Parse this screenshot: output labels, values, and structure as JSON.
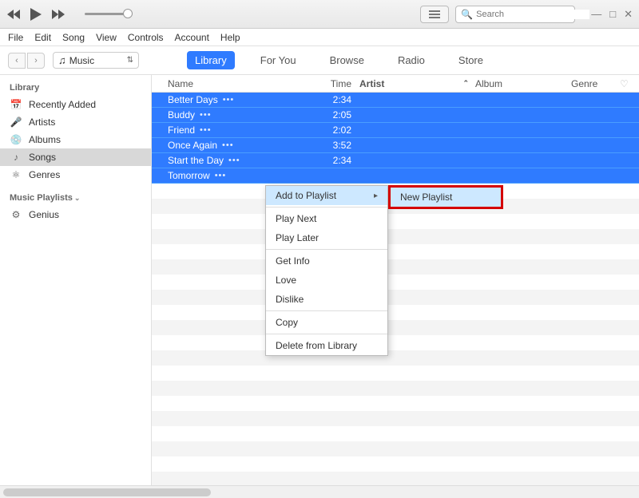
{
  "search": {
    "placeholder": "Search"
  },
  "menus": [
    "File",
    "Edit",
    "Song",
    "View",
    "Controls",
    "Account",
    "Help"
  ],
  "mediaPicker": {
    "label": "Music"
  },
  "tabs": [
    {
      "label": "Library",
      "active": true
    },
    {
      "label": "For You"
    },
    {
      "label": "Browse"
    },
    {
      "label": "Radio"
    },
    {
      "label": "Store"
    }
  ],
  "sidebar": {
    "libraryHeader": "Library",
    "libraryItems": [
      {
        "icon": "📅",
        "label": "Recently Added"
      },
      {
        "icon": "🎤",
        "label": "Artists"
      },
      {
        "icon": "💿",
        "label": "Albums"
      },
      {
        "icon": "♪",
        "label": "Songs",
        "selected": true
      },
      {
        "icon": "⚛",
        "label": "Genres"
      }
    ],
    "playlistsHeader": "Music Playlists",
    "playlistItems": [
      {
        "icon": "⚙",
        "label": "Genius"
      }
    ]
  },
  "columns": {
    "name": "Name",
    "time": "Time",
    "artist": "Artist",
    "album": "Album",
    "genre": "Genre"
  },
  "songs": [
    {
      "name": "Better Days",
      "time": "2:34"
    },
    {
      "name": "Buddy",
      "time": "2:05"
    },
    {
      "name": "Friend",
      "time": "2:02"
    },
    {
      "name": "Once Again",
      "time": "3:52"
    },
    {
      "name": "Start the Day",
      "time": "2:34"
    },
    {
      "name": "Tomorrow",
      "time": ""
    }
  ],
  "contextMenu": {
    "addToPlaylist": "Add to Playlist",
    "playNext": "Play Next",
    "playLater": "Play Later",
    "getInfo": "Get Info",
    "love": "Love",
    "dislike": "Dislike",
    "copy": "Copy",
    "deleteFromLibrary": "Delete from Library"
  },
  "submenu": {
    "newPlaylist": "New Playlist"
  }
}
